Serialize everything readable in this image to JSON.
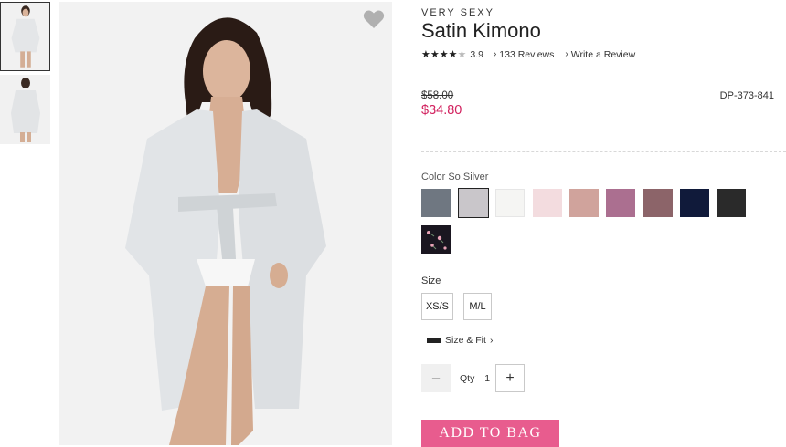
{
  "product": {
    "brand": "VERY SEXY",
    "title": "Satin Kimono",
    "rating": "3.9",
    "rating_stars": 3.9,
    "reviews_link": "133 Reviews",
    "write_review_link": "Write a Review",
    "old_price": "$58.00",
    "price": "$34.80",
    "sku": "DP-373-841"
  },
  "color": {
    "label": "Color So Silver",
    "swatches": [
      "#6f7781",
      "#c9c6ca",
      "#f5f5f3",
      "#f3dcdf",
      "#d0a39c",
      "#ab6f90",
      "#8c6469",
      "#101a3a",
      "#2a2a2a",
      "#1a1620"
    ]
  },
  "size": {
    "label": "Size",
    "options": [
      "XS/S",
      "M/L"
    ]
  },
  "fit_link": "Size & Fit",
  "quantity": {
    "minus": "–",
    "label": "Qty",
    "value": "1",
    "plus": "+"
  },
  "add_to_bag": "ADD TO BAG",
  "colors": {
    "price_sale": "#d2225f",
    "button": "#e85c8e"
  }
}
